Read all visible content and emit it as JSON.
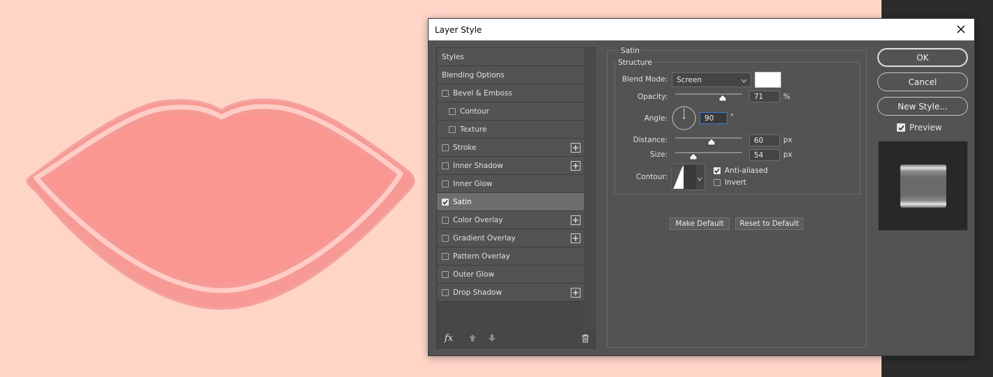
{
  "dialog": {
    "title": "Layer Style",
    "sidebar": {
      "items": [
        {
          "label": "Styles",
          "checkbox": false,
          "checked": false,
          "plus": false,
          "indent": false
        },
        {
          "label": "Blending Options",
          "checkbox": false,
          "checked": false,
          "plus": false,
          "indent": false
        },
        {
          "label": "Bevel & Emboss",
          "checkbox": true,
          "checked": false,
          "plus": false,
          "indent": false
        },
        {
          "label": "Contour",
          "checkbox": true,
          "checked": false,
          "plus": false,
          "indent": true
        },
        {
          "label": "Texture",
          "checkbox": true,
          "checked": false,
          "plus": false,
          "indent": true
        },
        {
          "label": "Stroke",
          "checkbox": true,
          "checked": false,
          "plus": true,
          "indent": false
        },
        {
          "label": "Inner Shadow",
          "checkbox": true,
          "checked": false,
          "plus": true,
          "indent": false
        },
        {
          "label": "Inner Glow",
          "checkbox": true,
          "checked": false,
          "plus": false,
          "indent": false
        },
        {
          "label": "Satin",
          "checkbox": true,
          "checked": true,
          "plus": false,
          "indent": false
        },
        {
          "label": "Color Overlay",
          "checkbox": true,
          "checked": false,
          "plus": true,
          "indent": false
        },
        {
          "label": "Gradient Overlay",
          "checkbox": true,
          "checked": false,
          "plus": true,
          "indent": false
        },
        {
          "label": "Pattern Overlay",
          "checkbox": true,
          "checked": false,
          "plus": false,
          "indent": false
        },
        {
          "label": "Outer Glow",
          "checkbox": true,
          "checked": false,
          "plus": false,
          "indent": false
        },
        {
          "label": "Drop Shadow",
          "checkbox": true,
          "checked": false,
          "plus": true,
          "indent": false
        }
      ],
      "footer": {
        "fx_label": "fx"
      }
    },
    "panel": {
      "section_title": "Satin",
      "structure_title": "Structure",
      "blend_mode": {
        "label": "Blend Mode:",
        "value": "Screen",
        "swatch_color": "#ffffff"
      },
      "opacity": {
        "label": "Opacity:",
        "value": "71",
        "unit": "%",
        "level": 0.71
      },
      "angle": {
        "label": "Angle:",
        "value": "90",
        "unit": "°",
        "degrees": 90
      },
      "distance": {
        "label": "Distance:",
        "value": "60",
        "unit": "px",
        "level": 0.5
      },
      "size": {
        "label": "Size:",
        "value": "54",
        "unit": "px",
        "level": 0.27
      },
      "contour": {
        "label": "Contour:"
      },
      "anti_aliased": {
        "label": "Anti-aliased",
        "checked": true
      },
      "invert": {
        "label": "Invert",
        "checked": false
      },
      "make_default_label": "Make Default",
      "reset_default_label": "Reset to Default"
    },
    "buttons": {
      "ok": "OK",
      "cancel": "Cancel",
      "new_style": "New Style..."
    },
    "preview": {
      "label": "Preview",
      "checked": true
    }
  },
  "colors": {
    "canvas_bg": "#ffd5c8",
    "lip_fill": "#fb9590",
    "lip_highlight": "#ffc8c2",
    "dialog_bg": "#535353",
    "active_item": "#6e6e6e"
  }
}
